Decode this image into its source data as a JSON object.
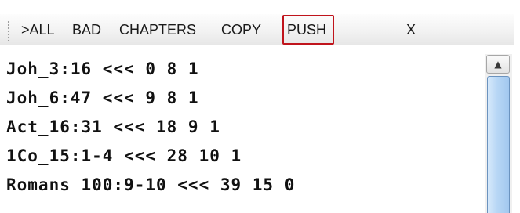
{
  "toolbar": {
    "buttons": [
      {
        "label": ">ALL"
      },
      {
        "label": "BAD"
      },
      {
        "label": "CHAPTERS"
      },
      {
        "label": "COPY"
      },
      {
        "label": "PUSH"
      },
      {
        "label": "X"
      }
    ],
    "highlight_color": "#c0141c"
  },
  "editor": {
    "lines": [
      "Joh_3:16 <<< 0 8 1",
      "Joh_6:47 <<< 9 8 1",
      "Act_16:31 <<< 18 9 1",
      "1Co_15:1-4 <<< 28 10 1",
      "Romans 100:9-10 <<< 39 15 0"
    ]
  },
  "scrollbar": {
    "up_arrow_icon": "triangle-up-icon",
    "thumb_color": "#a2c8ef"
  }
}
